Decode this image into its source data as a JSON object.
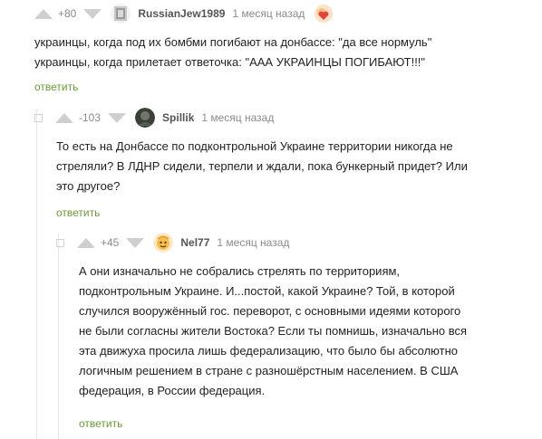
{
  "comments": [
    {
      "score": "+80",
      "author": "RussianJew1989",
      "time": "1 месяц назад",
      "lines": [
        "украинцы, когда под их бомбми погибают на донбассе: \"да все нормуль\"",
        "украинцы, когда прилетает ответочка: \"ААА УКРАИНЦЫ ПОГИБАЮТ!!!\""
      ],
      "reply_label": "ответить"
    },
    {
      "score": "-103",
      "author": "Spillik",
      "time": "1 месяц назад",
      "lines": [
        "То есть на Донбассе по подконтрольной Украине территории никогда не",
        "стреляли? В ЛДНР сидели, терпели и ждали, пока бункерный придет? Или",
        "это другое?"
      ],
      "reply_label": "ответить"
    },
    {
      "score": "+45",
      "author": "Nel77",
      "time": "1 месяц назад",
      "lines": [
        "А они изначально не собрались стрелять по территориям,",
        "подконтрольным Украине. И...постой, какой Украине? Той, в которой",
        "случился вооружённый гос. переворот, с основными идеями которого",
        "не были согласны жители Востока? Если ты помнишь, изначально вся",
        "эта движуха просила лишь федерализацию, что было бы абсолютно",
        "логичным решением в стране с разношёрстным населением. В США",
        "федерация, в России федерация."
      ],
      "reply_label": "ответить"
    }
  ],
  "icons": {
    "vote_up": "arrow-up-icon",
    "vote_down": "arrow-down-icon",
    "collapse": "collapse-square-icon",
    "award": "heart-award-icon"
  },
  "colors": {
    "reply_link": "#6a9a3a",
    "meta_gray": "#8b8b8b",
    "vote_arrow": "#cfcfcf"
  }
}
